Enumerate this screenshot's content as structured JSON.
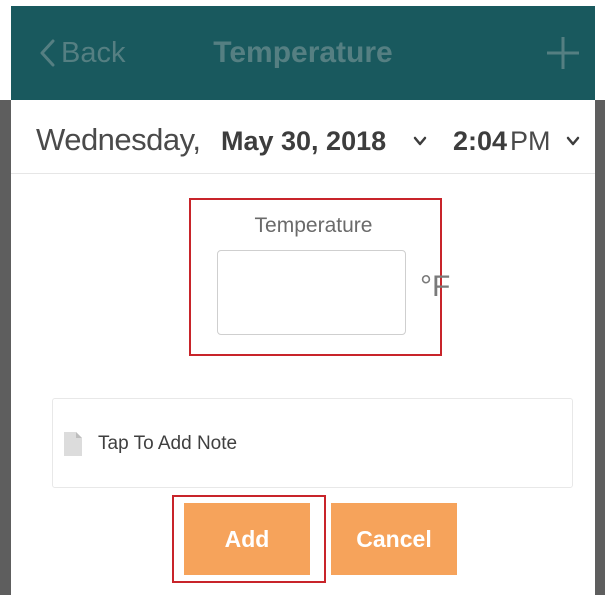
{
  "nav": {
    "back_label": "Back",
    "title": "Temperature",
    "add_icon": "plus-icon",
    "back_icon": "chevron-left-icon"
  },
  "date_row": {
    "day": "Wednesday,",
    "date": "May 30, 2018",
    "time": "2:04",
    "ampm": "PM"
  },
  "temperature": {
    "label": "Temperature",
    "value": "",
    "unit": "°F"
  },
  "note": {
    "label": "Tap To Add Note",
    "icon": "note-icon"
  },
  "buttons": {
    "add": "Add",
    "cancel": "Cancel"
  },
  "colors": {
    "navbar": "#19595e",
    "nav_text": "#557f82",
    "button": "#f6a35b",
    "highlight": "#c8242a"
  }
}
